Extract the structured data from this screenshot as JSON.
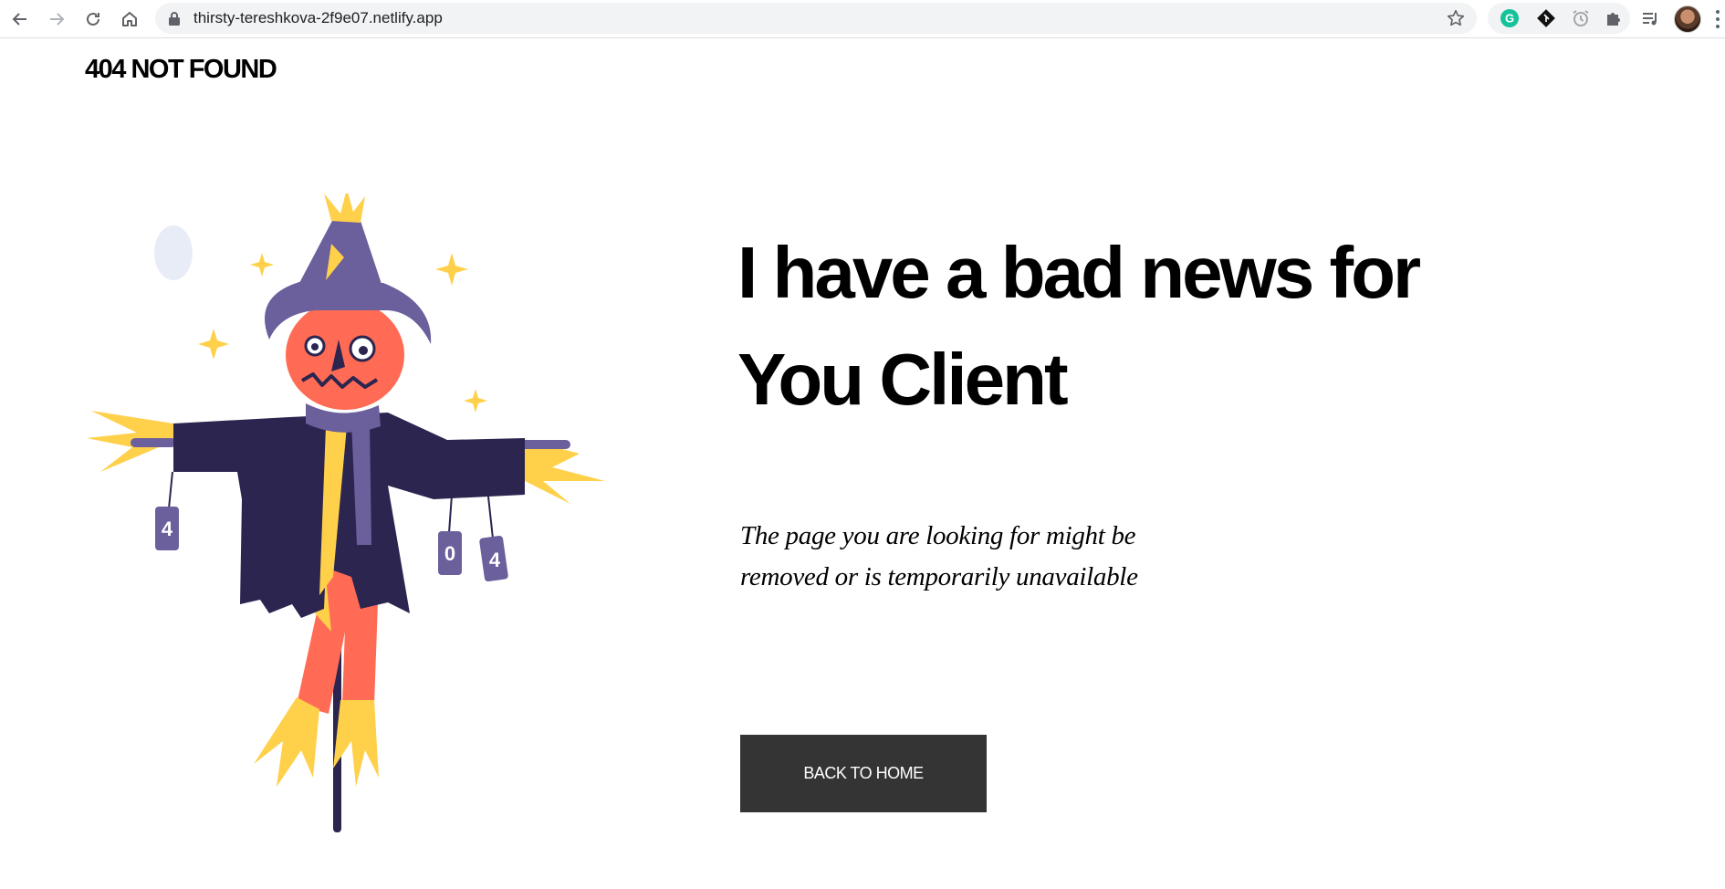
{
  "browser": {
    "url": "thirsty-tereshkova-2f9e07.netlify.app",
    "icons": {
      "back": "back-arrow-icon",
      "forward": "forward-arrow-icon",
      "reload": "reload-icon",
      "home": "home-icon",
      "lock": "lock-icon",
      "bookmark": "star-icon",
      "extensions": [
        "grammarly-icon",
        "git-icon",
        "alarm-icon",
        "puzzle-icon"
      ],
      "media": "media-queue-icon",
      "profile": "avatar",
      "menu": "more-vert-icon"
    }
  },
  "page": {
    "brand": "404 NOT FOUND",
    "headline_line1": "I have a bad news for",
    "headline_line2": "You Client",
    "subtext_line1": "The page you are looking for might be",
    "subtext_line2": "removed or is temporarily unavailable",
    "button_label": "BACK TO HOME",
    "illustration": {
      "description_icon": "scarecrow-icon",
      "cans": [
        "4",
        "0",
        "4"
      ]
    }
  },
  "colors": {
    "button_bg": "#343434",
    "hat": "#6b5f9c",
    "face": "#ff6b54",
    "straw": "#ffd04a",
    "coat": "#2b2550"
  }
}
